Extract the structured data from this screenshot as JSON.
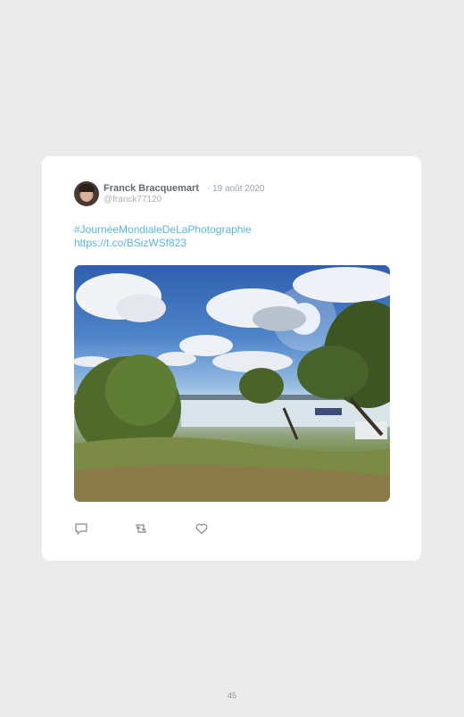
{
  "tweet": {
    "author_name": "Franck Bracquemart",
    "date": "· 19 août 2020",
    "handle": "@franck77120",
    "hashtag": "#JournéeMondialeDeLaPhotographie",
    "link": "https://t.co/BSizWSf823"
  },
  "photo": {
    "subject": "lakeside landscape with trees, clouds and sun"
  },
  "actions": {
    "reply_icon": "reply-icon",
    "retweet_icon": "retweet-icon",
    "like_icon": "heart-icon"
  },
  "footer": {
    "page_number": "45"
  }
}
